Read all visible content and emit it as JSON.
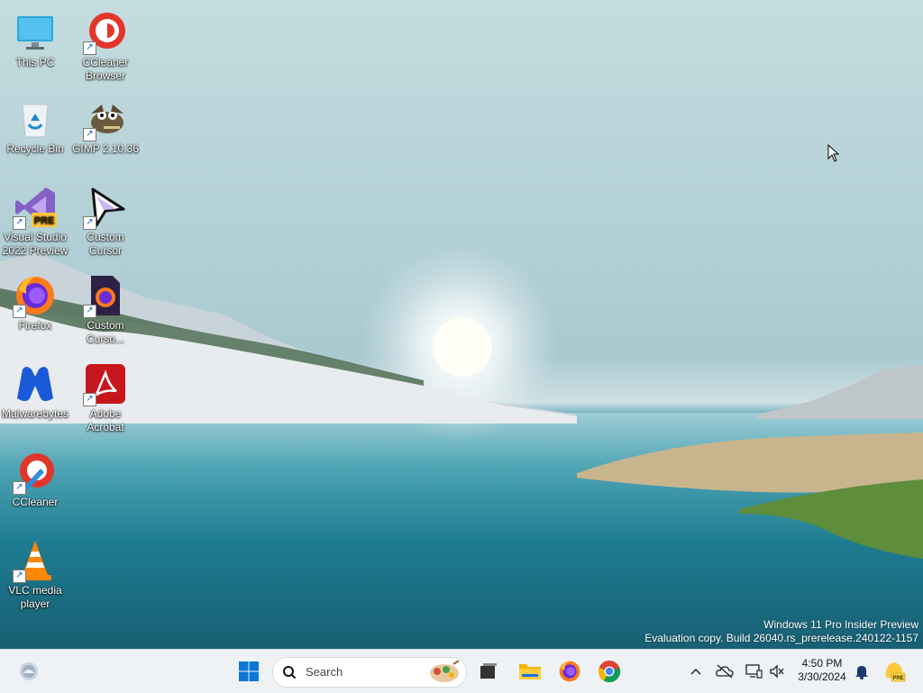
{
  "desktop": {
    "icons": [
      {
        "label": "This PC",
        "icon": "this-pc-icon"
      },
      {
        "label": "CCleaner Browser",
        "icon": "ccleaner-browser-icon"
      },
      {
        "label": "Recycle Bin",
        "icon": "recycle-bin-icon"
      },
      {
        "label": "GIMP 2.10.36",
        "icon": "gimp-icon"
      },
      {
        "label": "Visual Studio 2022 Preview",
        "icon": "visual-studio-preview-icon"
      },
      {
        "label": "Custom Cursor",
        "icon": "custom-cursor-icon"
      },
      {
        "label": "Firefox",
        "icon": "firefox-icon"
      },
      {
        "label": "Custom Curso...",
        "icon": "custom-cursor-file-icon"
      },
      {
        "label": "Malwarebytes",
        "icon": "malwarebytes-icon"
      },
      {
        "label": "Adobe Acrobat",
        "icon": "adobe-acrobat-icon"
      },
      {
        "label": "CCleaner",
        "icon": "ccleaner-icon"
      },
      {
        "label": "VLC media player",
        "icon": "vlc-icon"
      }
    ],
    "watermark": {
      "line1": "Windows 11 Pro Insider Preview",
      "line2": "Evaluation copy. Build 26040.rs_prerelease.240122-1157"
    }
  },
  "taskbar": {
    "search_placeholder": "Search",
    "pinned": [
      {
        "name": "start-button",
        "icon": "windows-logo-icon"
      },
      {
        "name": "task-view",
        "icon": "task-view-icon"
      },
      {
        "name": "file-explorer",
        "icon": "folder-icon"
      },
      {
        "name": "firefox",
        "icon": "firefox-icon"
      },
      {
        "name": "chrome",
        "icon": "chrome-icon"
      }
    ],
    "tray": {
      "time": "4:50 PM",
      "date": "3/30/2024",
      "badge": "PRE"
    }
  },
  "colors": {
    "taskbar_bg": "#eef2f5",
    "windows_blue": "#0a78d7",
    "text_white": "#ffffff"
  }
}
